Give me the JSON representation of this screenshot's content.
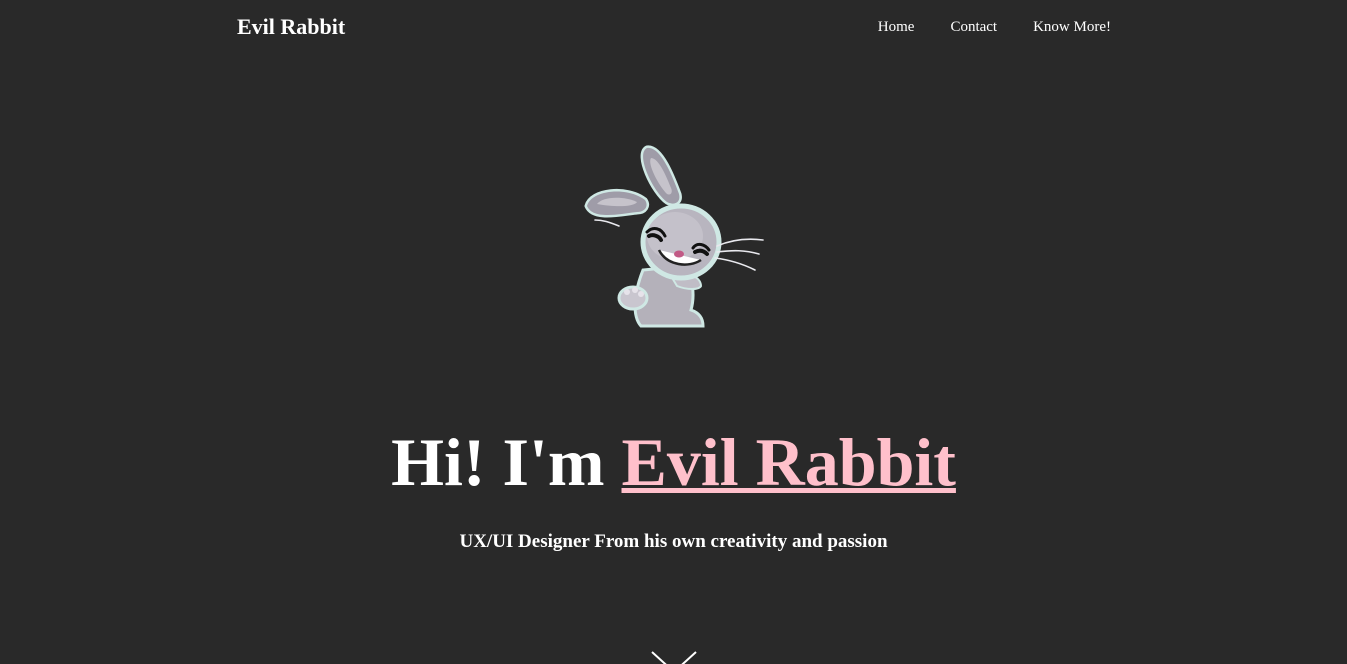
{
  "nav": {
    "brand": "Evil Rabbit",
    "links": [
      {
        "label": "Home"
      },
      {
        "label": "Contact"
      },
      {
        "label": "Know More!"
      }
    ]
  },
  "hero": {
    "image": "rabbit-mascot",
    "headline_prefix": "Hi! I'm ",
    "headline_name": "Evil Rabbit",
    "subtitle": "UX/UI Designer From his own creativity and passion",
    "scroll_icon": "chevron-down-icon"
  },
  "colors": {
    "background": "#292929",
    "text": "#ffffff",
    "accent": "#ffc0cb"
  }
}
